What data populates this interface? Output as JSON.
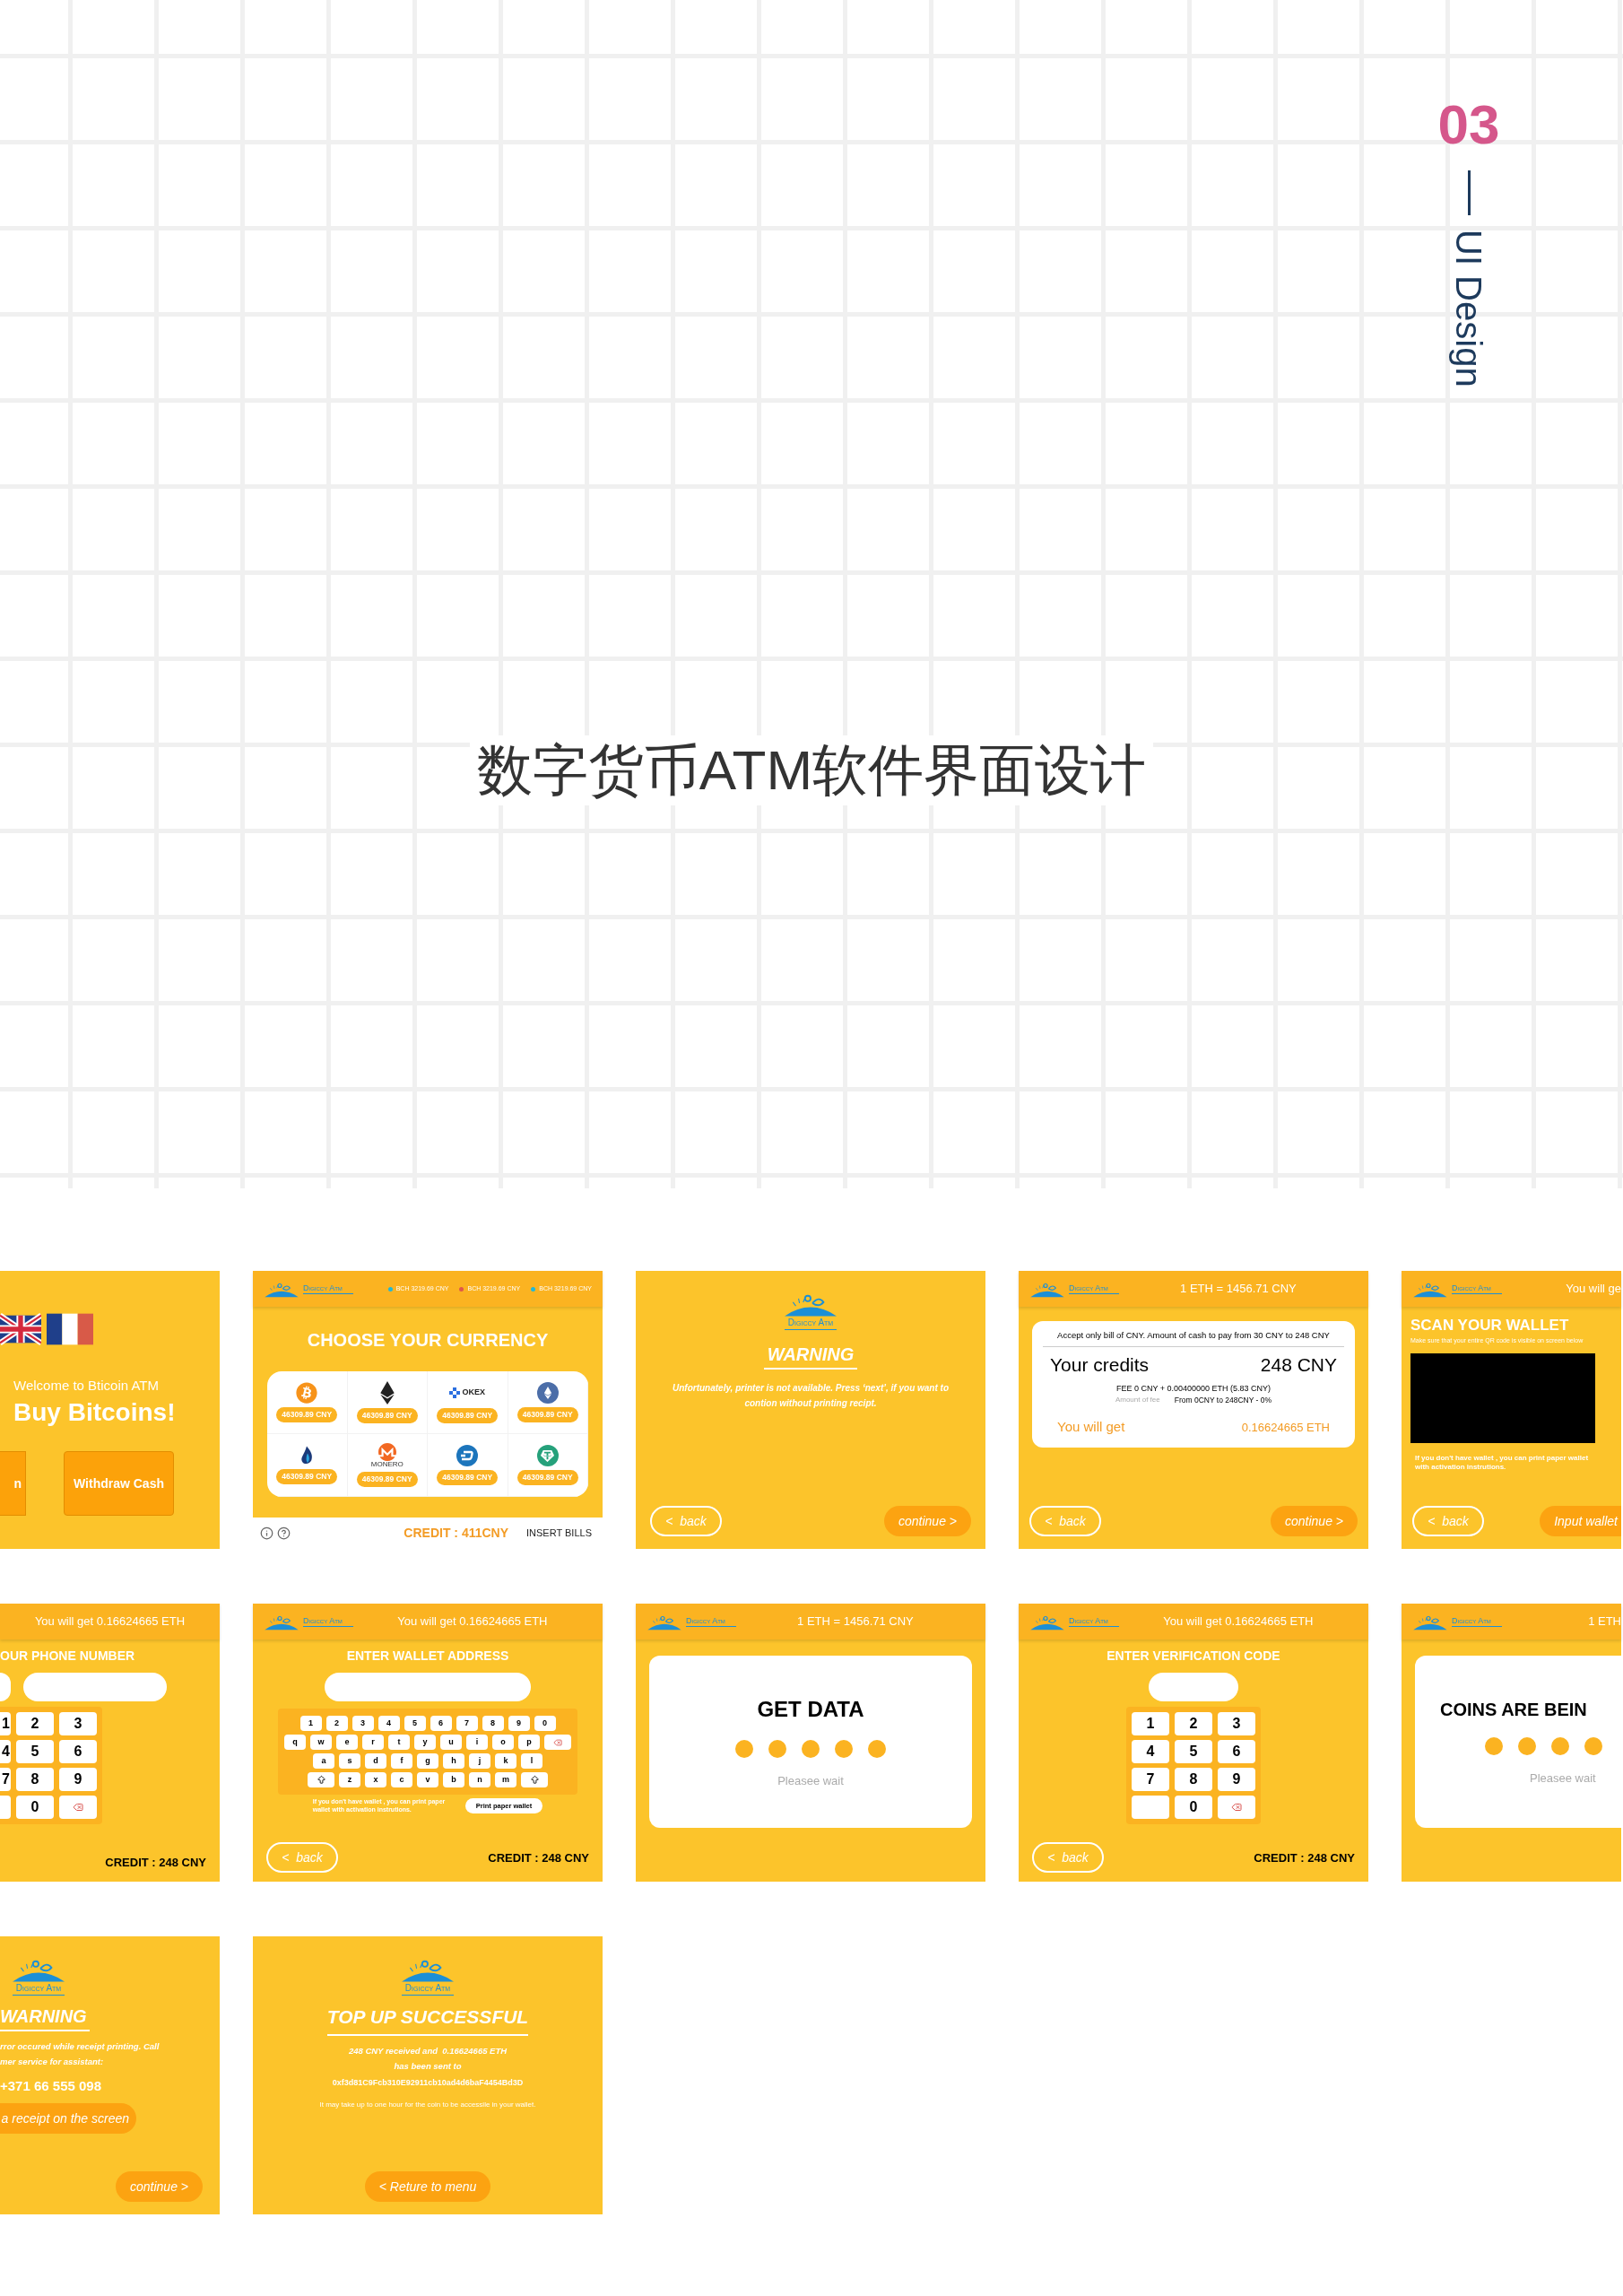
{
  "poster": {
    "number": "03",
    "label": "UI Design",
    "title": "数字货币ATM软件界面设计"
  },
  "screens": [
    {
      "kind": "welcome",
      "cropped_left": true,
      "welcome": "Welcome to Bticoin ATM",
      "headline": "Buy Bitcoins!",
      "buttons": [
        "n",
        "Withdraw Cash"
      ]
    },
    {
      "kind": "currency",
      "logo": "Digiccy Atm",
      "tickers": [
        {
          "label": "BCH 3219.69 CNY",
          "color": "#22b8d6"
        },
        {
          "label": "BCH 3219.69 CNY",
          "color": "#e0574a"
        },
        {
          "label": "BCH 3219.69 CNY",
          "color": "#22b8d6"
        }
      ],
      "title": "CHOOSE YOUR CURRENCY",
      "coins": [
        {
          "kind": "bitcoin",
          "price": "46309.89 CNY"
        },
        {
          "kind": "ether",
          "price": "46309.89 CNY"
        },
        {
          "kind": "okex",
          "name": "OKEX",
          "price": "46309.89 CNY"
        },
        {
          "kind": "ether-coin",
          "price": "46309.89 CNY"
        },
        {
          "kind": "huobi",
          "price": "46309.89 CNY"
        },
        {
          "kind": "monero",
          "name": "MONERO",
          "price": "46309.89 CNY"
        },
        {
          "kind": "dash",
          "price": "46309.89 CNY"
        },
        {
          "kind": "tether",
          "price": "46309.89 CNY"
        }
      ],
      "credit": "CREDIT : 411CNY",
      "insert": "INSERT BILLS"
    },
    {
      "kind": "notice",
      "logo": "Digiccy Atm",
      "title": "WARNING",
      "message": "Unfortunately, printer is not available. Press ‘next’, if you want to contion without printing recipt.",
      "back": "<  back",
      "continue": "continue >"
    },
    {
      "kind": "credits",
      "logo": "Digiccy Atm",
      "header": "1 ETH = 1456.71 CNY",
      "note": "Accept only bill of CNY. Amount of cash to pay from 30 CNY to 248 CNY",
      "credits_label": "Your credits",
      "credits": "248 CNY",
      "fee": "FEE 0 CNY + 0.00400000 ETH (5.83 CNY)",
      "fee_label": "Amount of fee",
      "fee_range": "From 0CNY to 248CNY - 0%",
      "get_label": "You will get",
      "get": "0.16624665 ETH",
      "back": "<  back",
      "continue": "continue >"
    },
    {
      "kind": "scan",
      "cropped_right": true,
      "logo": "Digiccy Atm",
      "header": "You will ge",
      "title": "SCAN YOUR WALLET",
      "hint": "Make sure that your entire QR code is visible on screen below",
      "note": "If you  don't  have  wallet , you  can print paper wallet  with activation instrutions.",
      "back": "<  back",
      "action": "Input wallet"
    },
    {
      "kind": "keypad",
      "cropped_left": true,
      "header": "You will get 0.16624665 ETH",
      "title": "OUR PHONE NUMBER",
      "keys": [
        [
          {
            "kind": "digit",
            "label": "1"
          },
          {
            "kind": "digit",
            "label": "2"
          },
          {
            "kind": "digit",
            "label": "3"
          }
        ],
        [
          {
            "kind": "digit",
            "label": "4"
          },
          {
            "kind": "digit",
            "label": "5"
          },
          {
            "kind": "digit",
            "label": "6"
          }
        ],
        [
          {
            "kind": "digit",
            "label": "7"
          },
          {
            "kind": "digit",
            "label": "8"
          },
          {
            "kind": "digit",
            "label": "9"
          }
        ],
        [
          {
            "kind": "blank"
          },
          {
            "kind": "digit",
            "label": "0"
          },
          {
            "kind": "delete"
          }
        ]
      ],
      "credit": "CREDIT : 248 CNY"
    },
    {
      "kind": "wallet",
      "logo": "Digiccy Atm",
      "header": "You will get 0.16624665 ETH",
      "title": "ENTER WALLET ADDRESS",
      "keyboard": [
        {
          "keys": [
            "1",
            "2",
            "3",
            "4",
            "5",
            "6",
            "7",
            "8",
            "9",
            "0"
          ]
        },
        {
          "keys": [
            "q",
            "w",
            "e",
            "r",
            "t",
            "y",
            "u",
            "i",
            "o",
            "p"
          ],
          "delete_key": true
        },
        {
          "keys": [
            "a",
            "s",
            "d",
            "f",
            "g",
            "h",
            "j",
            "k",
            "l"
          ]
        },
        {
          "keys": [
            "z",
            "x",
            "c",
            "v",
            "b",
            "n",
            "m"
          ],
          "shift_keys": true
        }
      ],
      "note": "If you  don't  have  wallet , you  can print paper wallet  with activation instrutions.",
      "print": "Print paper wallet",
      "back": "<  back",
      "credit": "CREDIT : 248 CNY"
    },
    {
      "kind": "loading",
      "logo": "Digiccy Atm",
      "header": "1 ETH = 1456.71 CNY",
      "title": "GET DATA",
      "wait": "Pleasee wait"
    },
    {
      "kind": "keypad",
      "logo": "Digiccy Atm",
      "header": "You will get 0.16624665 ETH",
      "title": "ENTER VERIFICATION CODE",
      "keys": [
        [
          {
            "kind": "digit",
            "label": "1"
          },
          {
            "kind": "digit",
            "label": "2"
          },
          {
            "kind": "digit",
            "label": "3"
          }
        ],
        [
          {
            "kind": "digit",
            "label": "4"
          },
          {
            "kind": "digit",
            "label": "5"
          },
          {
            "kind": "digit",
            "label": "6"
          }
        ],
        [
          {
            "kind": "digit",
            "label": "7"
          },
          {
            "kind": "digit",
            "label": "8"
          },
          {
            "kind": "digit",
            "label": "9"
          }
        ],
        [
          {
            "kind": "blank"
          },
          {
            "kind": "digit",
            "label": "0"
          },
          {
            "kind": "delete"
          }
        ]
      ],
      "back": "<  back",
      "credit": "CREDIT : 248 CNY"
    },
    {
      "kind": "loading",
      "cropped_right": true,
      "logo": "Digiccy Atm",
      "header": "1 ETH",
      "title": "COINS ARE BEIN",
      "wait": "Pleasee wait"
    },
    {
      "kind": "alert",
      "cropped_left": true,
      "logo": "Digiccy Atm",
      "title": "WARNING",
      "lines": [
        "rror occured while receipt printing. Call",
        "mer service for assistant:"
      ],
      "phone": "+371 66 555 098",
      "action": "a receipt on the screen",
      "continue": "continue >"
    },
    {
      "kind": "success",
      "logo": "Digiccy Atm",
      "title": "TOP UP SUCCESSFUL",
      "lines": [
        "248 CNY received and  0.16624665 ETH",
        "has been sent to"
      ],
      "address": "0xf3d81C9Fcb310E92911cb10ad4d6baF4454Bd3D",
      "note": "It may  take up  to  one  hour for  the coin to be accessile in your wallet.",
      "action": "< Reture to menu"
    }
  ]
}
